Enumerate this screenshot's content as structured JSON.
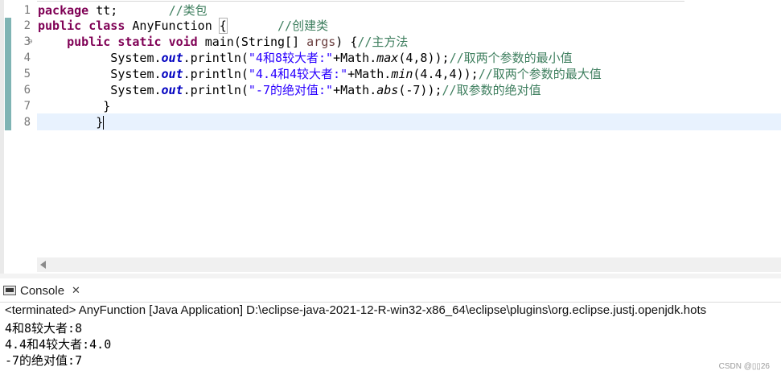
{
  "editor": {
    "lines": [
      {
        "num": "1",
        "parts": [
          {
            "t": "package",
            "c": "kw"
          },
          {
            "t": " tt;       ",
            "c": ""
          },
          {
            "t": "//类包",
            "c": "cm"
          }
        ]
      },
      {
        "num": "2",
        "parts": [
          {
            "t": "public",
            "c": "kw"
          },
          {
            "t": " ",
            "c": ""
          },
          {
            "t": "class",
            "c": "kw"
          },
          {
            "t": " AnyFunction ",
            "c": ""
          },
          {
            "t": "{",
            "c": "bracket"
          },
          {
            "t": "       ",
            "c": ""
          },
          {
            "t": "//创建类",
            "c": "cm"
          }
        ]
      },
      {
        "num": "3",
        "fold": "⊖",
        "parts": [
          {
            "t": "    ",
            "c": ""
          },
          {
            "t": "public",
            "c": "kw"
          },
          {
            "t": " ",
            "c": ""
          },
          {
            "t": "static",
            "c": "kw"
          },
          {
            "t": " ",
            "c": ""
          },
          {
            "t": "void",
            "c": "kw"
          },
          {
            "t": " main(String[] ",
            "c": ""
          },
          {
            "t": "args",
            "c": "prm"
          },
          {
            "t": ") {",
            "c": ""
          },
          {
            "t": "//主方法",
            "c": "cm"
          }
        ]
      },
      {
        "num": "4",
        "parts": [
          {
            "t": "          System.",
            "c": ""
          },
          {
            "t": "out",
            "c": "fld"
          },
          {
            "t": ".println(",
            "c": ""
          },
          {
            "t": "\"4和8较大者:\"",
            "c": "st"
          },
          {
            "t": "+Math.",
            "c": ""
          },
          {
            "t": "max",
            "c": "sm"
          },
          {
            "t": "(4,8));",
            "c": ""
          },
          {
            "t": "//取两个参数的最小值",
            "c": "cm"
          }
        ]
      },
      {
        "num": "5",
        "parts": [
          {
            "t": "          System.",
            "c": ""
          },
          {
            "t": "out",
            "c": "fld"
          },
          {
            "t": ".println(",
            "c": ""
          },
          {
            "t": "\"4.4和4较大者:\"",
            "c": "st"
          },
          {
            "t": "+Math.",
            "c": ""
          },
          {
            "t": "min",
            "c": "sm"
          },
          {
            "t": "(4.4,4));",
            "c": ""
          },
          {
            "t": "//取两个参数的最大值",
            "c": "cm"
          }
        ]
      },
      {
        "num": "6",
        "parts": [
          {
            "t": "          System.",
            "c": ""
          },
          {
            "t": "out",
            "c": "fld"
          },
          {
            "t": ".println(",
            "c": ""
          },
          {
            "t": "\"-7的绝对值:\"",
            "c": "st"
          },
          {
            "t": "+Math.",
            "c": ""
          },
          {
            "t": "abs",
            "c": "sm"
          },
          {
            "t": "(-7));",
            "c": ""
          },
          {
            "t": "//取参数的绝对值",
            "c": "cm"
          }
        ]
      },
      {
        "num": "7",
        "parts": [
          {
            "t": "         }",
            "c": ""
          }
        ]
      },
      {
        "num": "8",
        "parts": [
          {
            "t": "        }",
            "c": ""
          },
          {
            "t": "",
            "c": "caret"
          }
        ]
      }
    ]
  },
  "console": {
    "tab_label": "Console",
    "close_symbol": "✕",
    "terminated_text": "<terminated> AnyFunction [Java Application] D:\\eclipse-java-2021-12-R-win32-x86_64\\eclipse\\plugins\\org.eclipse.justj.openjdk.hots",
    "output": [
      "4和8较大者:8",
      "4.4和4较大者:4.0",
      "-7的绝对值:7"
    ]
  },
  "watermark": "CSDN @▯▯26"
}
